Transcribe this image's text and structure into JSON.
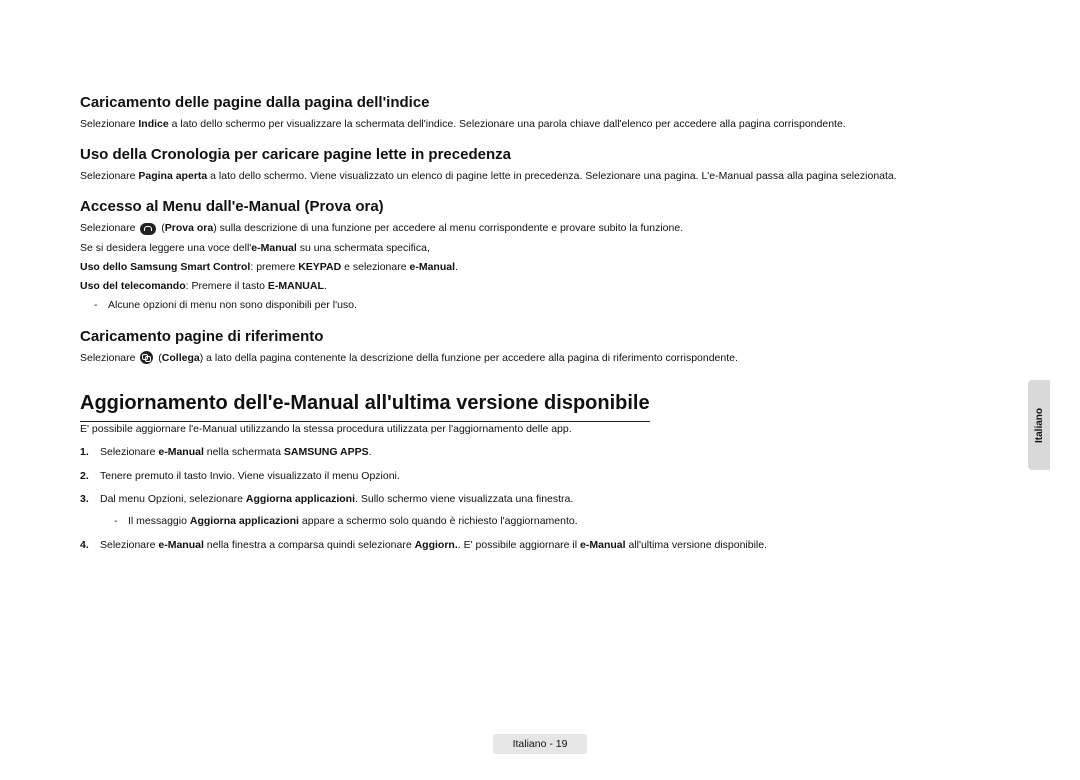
{
  "sections": {
    "s1": {
      "heading": "Caricamento delle pagine dalla pagina dell'indice",
      "p_pre": "Selezionare ",
      "p_bold": "Indice",
      "p_post": " a lato dello schermo per visualizzare la schermata dell'indice. Selezionare una parola chiave dall'elenco per accedere alla pagina corrispondente."
    },
    "s2": {
      "heading": "Uso della Cronologia per caricare pagine lette in precedenza",
      "p_pre": "Selezionare ",
      "p_bold": "Pagina aperta",
      "p_post": " a lato dello schermo. Viene visualizzato un elenco di pagine lette in precedenza. Selezionare una pagina. L'e-Manual passa alla pagina selezionata."
    },
    "s3": {
      "heading": "Accesso al Menu dall'e-Manual (Prova ora)",
      "line1_pre": "Selezionare ",
      "line1_paren_pre": " (",
      "line1_bold": "Prova ora",
      "line1_paren_post": ")",
      "line1_post": " sulla descrizione di una funzione per accedere al menu corrispondente e provare subito la funzione.",
      "line2_pre": "Se si desidera leggere una voce dell'",
      "line2_bold": "e-Manual",
      "line2_post": " su una schermata specifica,",
      "line3_bold1": "Uso dello Samsung Smart Control",
      "line3_mid": ": premere ",
      "line3_bold2": "KEYPAD",
      "line3_mid2": " e selezionare ",
      "line3_bold3": "e-Manual",
      "line3_end": ".",
      "line4_bold1": "Uso del telecomando",
      "line4_mid": ": Premere il tasto ",
      "line4_bold2": "E-MANUAL",
      "line4_end": ".",
      "bullet": "Alcune opzioni di menu non sono disponibili per l'uso."
    },
    "s4": {
      "heading": "Caricamento pagine di riferimento",
      "p_pre": "Selezionare ",
      "p_paren_pre": " (",
      "p_bold": "Collega",
      "p_paren_post": ")",
      "p_post": " a lato della pagina contenente la descrizione della funzione per accedere alla pagina di riferimento corrispondente."
    }
  },
  "main": {
    "heading": "Aggiornamento dell'e-Manual all'ultima versione disponibile",
    "intro": "E' possibile aggiornare l'e-Manual utilizzando la stessa procedura utilizzata per l'aggiornamento delle app.",
    "steps": {
      "n1": {
        "num": "1.",
        "pre": "Selezionare ",
        "b1": "e-Manual",
        "mid": " nella schermata ",
        "b2": "SAMSUNG APPS",
        "end": "."
      },
      "n2": {
        "num": "2.",
        "text": "Tenere premuto il tasto Invio. Viene visualizzato il menu Opzioni."
      },
      "n3": {
        "num": "3.",
        "pre": "Dal menu Opzioni, selezionare ",
        "b1": "Aggiorna applicazioni",
        "end": ". Sullo schermo viene visualizzata una finestra."
      },
      "n3sub": {
        "pre": "Il messaggio ",
        "b1": "Aggiorna applicazioni",
        "end": " appare a schermo solo quando è richiesto l'aggiornamento."
      },
      "n4": {
        "num": "4.",
        "pre": "Selezionare ",
        "b1": "e-Manual",
        "mid": " nella finestra a comparsa quindi selezionare ",
        "b2": "Aggiorn.",
        "mid2": ". E' possibile aggiornare il ",
        "b3": "e-Manual",
        "end": " all'ultima versione disponibile."
      }
    }
  },
  "side_tab": "Italiano",
  "footer": "Italiano - 19"
}
